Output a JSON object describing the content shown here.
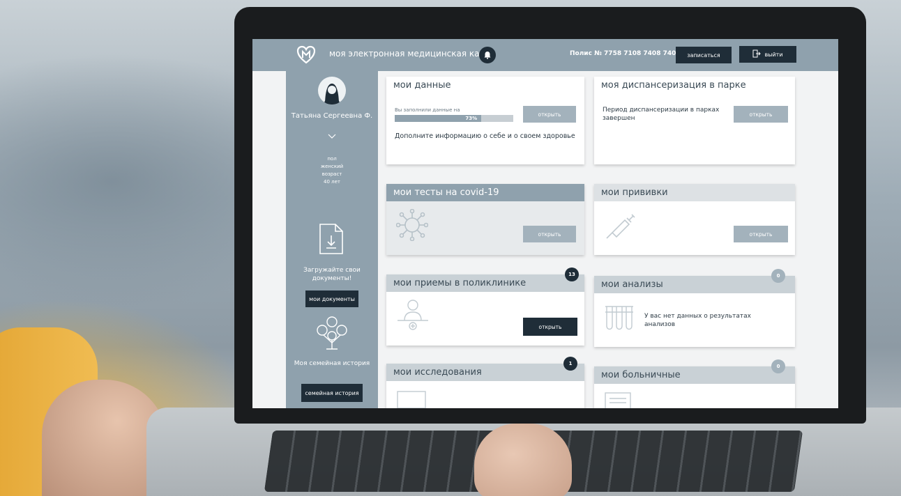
{
  "header": {
    "app_title": "моя электронная медицинская карта",
    "policy": "Полис № 7758 7108 7408 7408",
    "enroll_label": "записаться",
    "logout_label": "выйти"
  },
  "sidebar": {
    "user_name": "Татьяна Сергеевна Ф.",
    "gender_label": "пол",
    "gender_value": "женский",
    "age_label": "возраст",
    "age_value": "40 лет",
    "upload_text": "Загружайте свои документы!",
    "docs_button": "мои документы",
    "family_text": "Моя семейная история",
    "family_button": "семейная история"
  },
  "cards": {
    "my_data": {
      "title": "мои данные",
      "filled_label": "Вы заполнили данные на",
      "progress_text": "73%",
      "progress": 0.73,
      "hint": "Дополните информацию о себе и о своем здоровье",
      "button": "открыть"
    },
    "dispensary": {
      "title": "моя диспансеризация в парке",
      "text": "Период диспансеризации в парках завершен",
      "button": "открыть"
    },
    "covid": {
      "title": "мои тесты на covid-19",
      "button": "открыть"
    },
    "vaccines": {
      "title": "мои прививки",
      "button": "открыть"
    },
    "appointments": {
      "title": "мои приемы в поликлинике",
      "badge": "13",
      "button": "открыть"
    },
    "analyses": {
      "title": "мои анализы",
      "badge": "0",
      "text": "У вас нет данных о результатах анализов"
    },
    "research": {
      "title": "мои исследования",
      "badge": "1"
    },
    "sick_leave": {
      "title": "мои больничные",
      "badge": "0"
    }
  },
  "colors": {
    "accent": "#8fa1ad",
    "dark": "#1f2d38",
    "light_button": "#a3b2bc"
  }
}
